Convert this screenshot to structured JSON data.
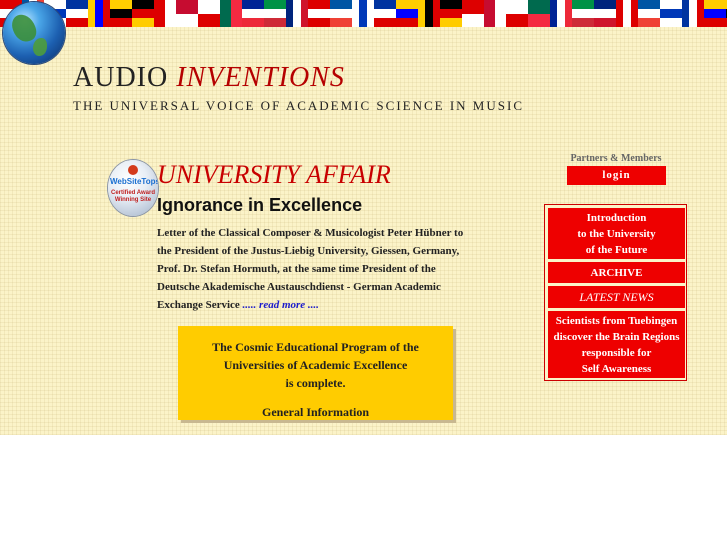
{
  "header": {
    "title_part1": "AUDIO",
    "title_part2": "INVENTIONS",
    "subtitle": "THE UNIVERSAL VOICE OF ACADEMIC SCIENCE IN MUSIC"
  },
  "award_badge": {
    "label": "WebSiteTops",
    "caption": "Certified Award Winning Site"
  },
  "main": {
    "title": "UNIVERSITY AFFAIR",
    "subtitle": "Ignorance in Excellence",
    "letter_text": "Letter of the Classical Composer & Musicologist Peter Hübner to the President of the Justus-Liebig University, Giessen, Germany, Prof. Dr. Stefan Hormuth, at the same time President of the Deutsche Akademische Austauschdienst - German Academic Exchange Service",
    "read_more": "..... read more ...."
  },
  "program_box": {
    "line1": "The Cosmic Educational Program of the",
    "line2": "Universities of Academic Excellence",
    "line3": "is complete.",
    "link": "General Information"
  },
  "sidebar": {
    "partners_label": "Partners & Members",
    "login_label": "login",
    "items": [
      {
        "label": "Introduction\nto the University\nof the Future"
      },
      {
        "label": "ARCHIVE"
      },
      {
        "label": "LATEST NEWS"
      },
      {
        "label": "Scientists from Tuebingen\ndiscover the Brain Regions\nresponsible for\nSelf Awareness"
      }
    ]
  },
  "colors": {
    "page_background": "#fbf3c8",
    "accent_red": "#ee0000",
    "title_red": "#c80000",
    "program_yellow": "#ffcc00",
    "link_blue": "#1a1acc"
  },
  "icons": {
    "globe": "globe-icon",
    "flags": "world-flags-banner",
    "award": "award-badge-icon"
  }
}
